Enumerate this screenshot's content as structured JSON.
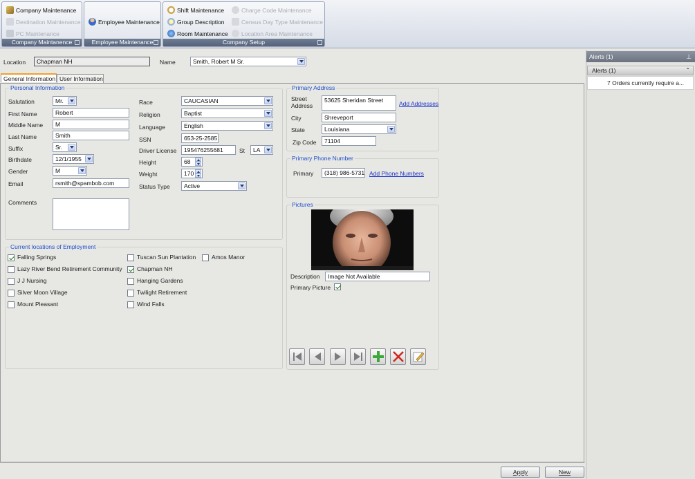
{
  "ribbon": {
    "company_group": {
      "caption": "Company Maintanence",
      "items": [
        "Company Maintenance",
        "Destination Maintenance",
        "PC Maintenance"
      ]
    },
    "employee_group": {
      "caption": "Employee Maintenance",
      "items": [
        "Employee Maintenance"
      ]
    },
    "setup_group": {
      "caption": "Company Setup",
      "items": [
        "Shift Maintenance",
        "Group Description",
        "Room Maintenance",
        "Charge Code Maintenance",
        "Census Day Type Maintenance",
        "Location Area Maintenance"
      ]
    }
  },
  "header": {
    "location_label": "Location",
    "location_value": "Chapman NH",
    "name_label": "Name",
    "name_value": "Smith, Robert M Sr."
  },
  "tabs": [
    "General Information",
    "User Information"
  ],
  "personal": {
    "title": "Personal Information",
    "salutation": {
      "label": "Salutation",
      "value": "Mr."
    },
    "first_name": {
      "label": "First Name",
      "value": "Robert"
    },
    "middle_name": {
      "label": "Middle Name",
      "value": "M"
    },
    "last_name": {
      "label": "Last Name",
      "value": "Smith"
    },
    "suffix": {
      "label": "Suffix",
      "value": "Sr."
    },
    "birthdate": {
      "label": "Birthdate",
      "value": "12/1/1955"
    },
    "gender": {
      "label": "Gender",
      "value": "M"
    },
    "email": {
      "label": "Email",
      "value": "rsmith@spambob.com"
    },
    "comments": {
      "label": "Comments",
      "value": ""
    },
    "race": {
      "label": "Race",
      "value": "CAUCASIAN"
    },
    "religion": {
      "label": "Religion",
      "value": "Baptist"
    },
    "language": {
      "label": "Language",
      "value": "English"
    },
    "ssn": {
      "label": "SSN",
      "value": "653-25-2585"
    },
    "driver_license": {
      "label": "Driver License",
      "value": "195476255681"
    },
    "dl_state": {
      "label": "St",
      "value": "LA"
    },
    "height": {
      "label": "Height",
      "value": "68"
    },
    "weight": {
      "label": "Weight",
      "value": "170"
    },
    "status_type": {
      "label": "Status Type",
      "value": "Active"
    }
  },
  "employment": {
    "title": "Current locations of Employment",
    "locations": [
      {
        "name": "Falling Springs",
        "checked": true
      },
      {
        "name": "Lazy River Bend Retirement Community",
        "checked": false
      },
      {
        "name": "J J Nursing",
        "checked": false
      },
      {
        "name": "Silver Moon Village",
        "checked": false
      },
      {
        "name": "Mount Pleasant",
        "checked": false
      },
      {
        "name": "Tuscan Sun Plantation",
        "checked": false
      },
      {
        "name": "Chapman NH",
        "checked": true
      },
      {
        "name": "Hanging Gardens",
        "checked": false
      },
      {
        "name": "Twilight Retirement",
        "checked": false
      },
      {
        "name": "Wind Falls",
        "checked": false
      },
      {
        "name": "Amos Manor",
        "checked": false
      }
    ]
  },
  "address": {
    "title": "Primary Address",
    "street": {
      "label": "Street Address",
      "value": "53625 Sheridan Street"
    },
    "add_link": "Add Addresses",
    "city": {
      "label": "City",
      "value": "Shreveport"
    },
    "state": {
      "label": "State",
      "value": "Louisiana"
    },
    "zip": {
      "label": "Zip Code",
      "value": "71104"
    }
  },
  "phone": {
    "title": "Primary Phone Number",
    "label": "Primary",
    "value": "(318) 986-5731",
    "add_link": "Add Phone Numbers"
  },
  "pictures": {
    "title": "Pictures",
    "description_label": "Description",
    "description_value": "Image Not Available",
    "primary_label": "Primary Picture",
    "primary_checked": true
  },
  "buttons": {
    "apply": "Apply",
    "new": "New"
  },
  "alerts": {
    "panel_title": "Alerts (1)",
    "group_title": "Alerts (1)",
    "item": "7 Orders currently require a..."
  },
  "colors": {
    "accent_blue": "#1f4fc9",
    "link": "#1d35c8",
    "ribbon_caption": "#5f6c84",
    "tab_highlight": "#f0a02a"
  }
}
